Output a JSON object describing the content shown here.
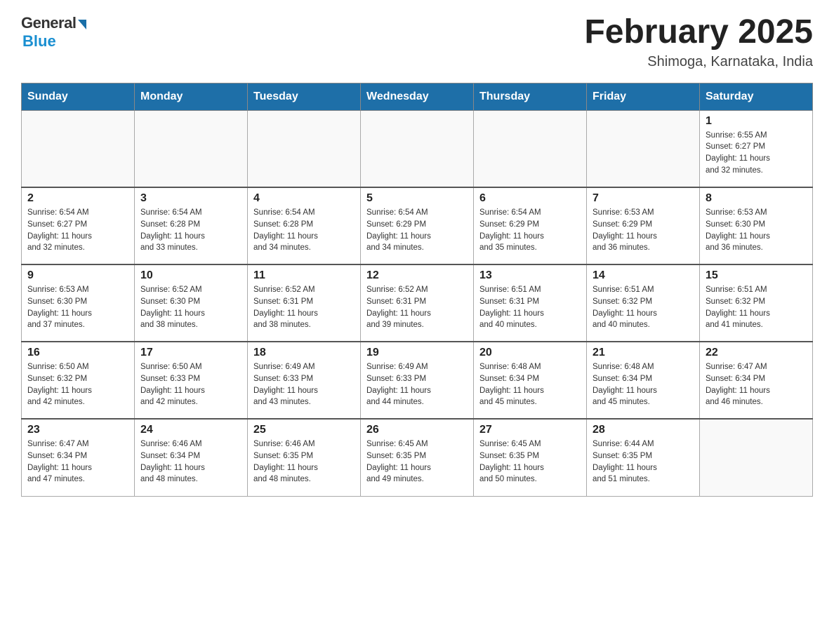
{
  "header": {
    "logo_general": "General",
    "logo_blue": "Blue",
    "month_title": "February 2025",
    "location": "Shimoga, Karnataka, India"
  },
  "weekdays": [
    "Sunday",
    "Monday",
    "Tuesday",
    "Wednesday",
    "Thursday",
    "Friday",
    "Saturday"
  ],
  "weeks": [
    [
      {
        "day": "",
        "info": ""
      },
      {
        "day": "",
        "info": ""
      },
      {
        "day": "",
        "info": ""
      },
      {
        "day": "",
        "info": ""
      },
      {
        "day": "",
        "info": ""
      },
      {
        "day": "",
        "info": ""
      },
      {
        "day": "1",
        "info": "Sunrise: 6:55 AM\nSunset: 6:27 PM\nDaylight: 11 hours\nand 32 minutes."
      }
    ],
    [
      {
        "day": "2",
        "info": "Sunrise: 6:54 AM\nSunset: 6:27 PM\nDaylight: 11 hours\nand 32 minutes."
      },
      {
        "day": "3",
        "info": "Sunrise: 6:54 AM\nSunset: 6:28 PM\nDaylight: 11 hours\nand 33 minutes."
      },
      {
        "day": "4",
        "info": "Sunrise: 6:54 AM\nSunset: 6:28 PM\nDaylight: 11 hours\nand 34 minutes."
      },
      {
        "day": "5",
        "info": "Sunrise: 6:54 AM\nSunset: 6:29 PM\nDaylight: 11 hours\nand 34 minutes."
      },
      {
        "day": "6",
        "info": "Sunrise: 6:54 AM\nSunset: 6:29 PM\nDaylight: 11 hours\nand 35 minutes."
      },
      {
        "day": "7",
        "info": "Sunrise: 6:53 AM\nSunset: 6:29 PM\nDaylight: 11 hours\nand 36 minutes."
      },
      {
        "day": "8",
        "info": "Sunrise: 6:53 AM\nSunset: 6:30 PM\nDaylight: 11 hours\nand 36 minutes."
      }
    ],
    [
      {
        "day": "9",
        "info": "Sunrise: 6:53 AM\nSunset: 6:30 PM\nDaylight: 11 hours\nand 37 minutes."
      },
      {
        "day": "10",
        "info": "Sunrise: 6:52 AM\nSunset: 6:30 PM\nDaylight: 11 hours\nand 38 minutes."
      },
      {
        "day": "11",
        "info": "Sunrise: 6:52 AM\nSunset: 6:31 PM\nDaylight: 11 hours\nand 38 minutes."
      },
      {
        "day": "12",
        "info": "Sunrise: 6:52 AM\nSunset: 6:31 PM\nDaylight: 11 hours\nand 39 minutes."
      },
      {
        "day": "13",
        "info": "Sunrise: 6:51 AM\nSunset: 6:31 PM\nDaylight: 11 hours\nand 40 minutes."
      },
      {
        "day": "14",
        "info": "Sunrise: 6:51 AM\nSunset: 6:32 PM\nDaylight: 11 hours\nand 40 minutes."
      },
      {
        "day": "15",
        "info": "Sunrise: 6:51 AM\nSunset: 6:32 PM\nDaylight: 11 hours\nand 41 minutes."
      }
    ],
    [
      {
        "day": "16",
        "info": "Sunrise: 6:50 AM\nSunset: 6:32 PM\nDaylight: 11 hours\nand 42 minutes."
      },
      {
        "day": "17",
        "info": "Sunrise: 6:50 AM\nSunset: 6:33 PM\nDaylight: 11 hours\nand 42 minutes."
      },
      {
        "day": "18",
        "info": "Sunrise: 6:49 AM\nSunset: 6:33 PM\nDaylight: 11 hours\nand 43 minutes."
      },
      {
        "day": "19",
        "info": "Sunrise: 6:49 AM\nSunset: 6:33 PM\nDaylight: 11 hours\nand 44 minutes."
      },
      {
        "day": "20",
        "info": "Sunrise: 6:48 AM\nSunset: 6:34 PM\nDaylight: 11 hours\nand 45 minutes."
      },
      {
        "day": "21",
        "info": "Sunrise: 6:48 AM\nSunset: 6:34 PM\nDaylight: 11 hours\nand 45 minutes."
      },
      {
        "day": "22",
        "info": "Sunrise: 6:47 AM\nSunset: 6:34 PM\nDaylight: 11 hours\nand 46 minutes."
      }
    ],
    [
      {
        "day": "23",
        "info": "Sunrise: 6:47 AM\nSunset: 6:34 PM\nDaylight: 11 hours\nand 47 minutes."
      },
      {
        "day": "24",
        "info": "Sunrise: 6:46 AM\nSunset: 6:34 PM\nDaylight: 11 hours\nand 48 minutes."
      },
      {
        "day": "25",
        "info": "Sunrise: 6:46 AM\nSunset: 6:35 PM\nDaylight: 11 hours\nand 48 minutes."
      },
      {
        "day": "26",
        "info": "Sunrise: 6:45 AM\nSunset: 6:35 PM\nDaylight: 11 hours\nand 49 minutes."
      },
      {
        "day": "27",
        "info": "Sunrise: 6:45 AM\nSunset: 6:35 PM\nDaylight: 11 hours\nand 50 minutes."
      },
      {
        "day": "28",
        "info": "Sunrise: 6:44 AM\nSunset: 6:35 PM\nDaylight: 11 hours\nand 51 minutes."
      },
      {
        "day": "",
        "info": ""
      }
    ]
  ]
}
